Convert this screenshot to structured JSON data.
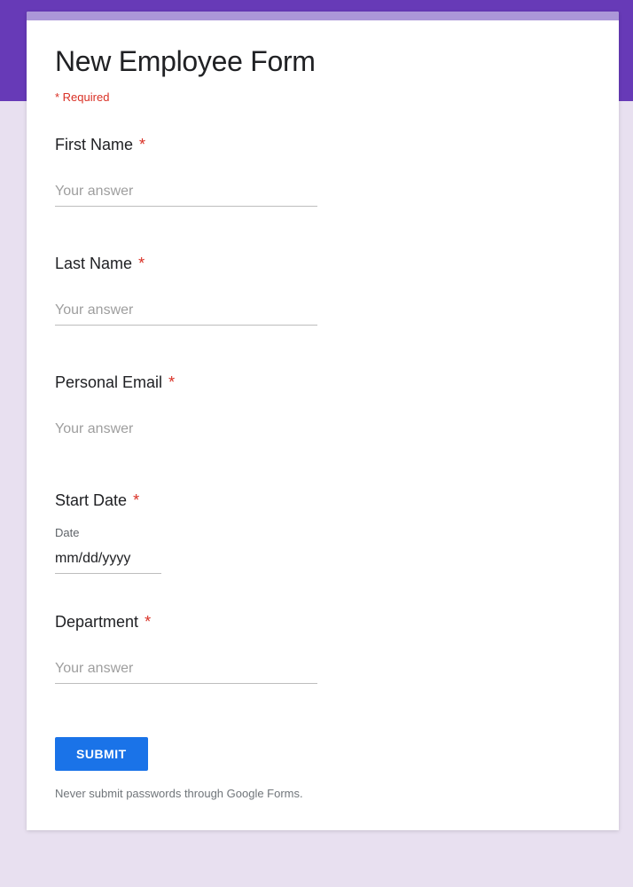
{
  "form": {
    "title": "New Employee Form",
    "required_note": "* Required",
    "questions": [
      {
        "label": "First Name",
        "required_mark": "*",
        "placeholder": "Your answer",
        "type": "text"
      },
      {
        "label": "Last Name",
        "required_mark": "*",
        "placeholder": "Your answer",
        "type": "text"
      },
      {
        "label": "Personal Email",
        "required_mark": "*",
        "placeholder": "Your answer",
        "type": "text_no_underline"
      },
      {
        "label": "Start Date",
        "required_mark": "*",
        "sublabel": "Date",
        "date_value": "mm/dd/yyyy",
        "type": "date"
      },
      {
        "label": "Department",
        "required_mark": "*",
        "placeholder": "Your answer",
        "type": "text"
      }
    ],
    "submit_label": "SUBMIT",
    "footer_note": "Never submit passwords through Google Forms."
  }
}
